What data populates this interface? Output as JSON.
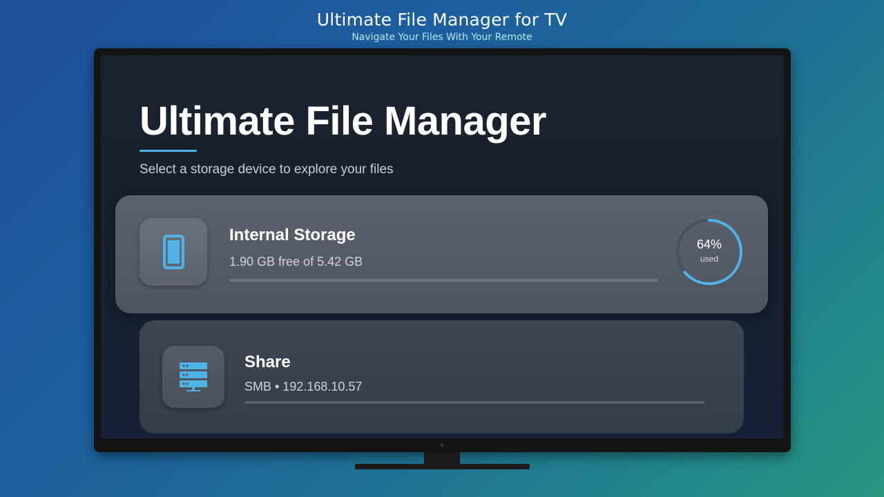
{
  "promo": {
    "title": "Ultimate File Manager for TV",
    "subtitle": "Navigate Your Files With Your Remote"
  },
  "app": {
    "title": "Ultimate File Manager",
    "subtitle": "Select a storage device to explore your files",
    "accent_color": "#4fb3e8"
  },
  "storage": [
    {
      "name": "Internal Storage",
      "detail": "1.90 GB free of 5.42 GB",
      "icon": "smartphone-icon",
      "used_percent_label": "64%",
      "used_label": "used",
      "used_fraction": 0.64,
      "focused": true
    },
    {
      "name": "Share",
      "detail": "SMB • 192.168.10.57",
      "icon": "server-icon",
      "focused": false
    }
  ]
}
